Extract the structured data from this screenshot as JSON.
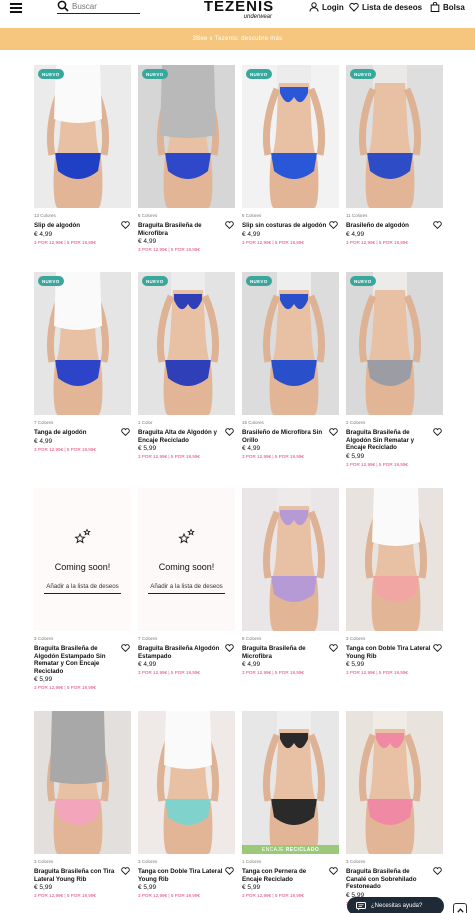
{
  "header": {
    "search_placeholder": "Buscar",
    "logo": "TEZENIS",
    "logo_sub": "underwear",
    "login": "Login",
    "wishlist": "Lista de deseos",
    "bag": "Bolsa"
  },
  "promo": "3Bee x Tezenis: descubre más",
  "colors": {
    "badge": "#3aa79c",
    "promo_bar": "#f6c67e",
    "promo_price": "#e0457b",
    "recycled": "#9ac97a"
  },
  "products": [
    {
      "badge": "NUEVO",
      "colors": "13 Colores",
      "title": "Slip de algodón",
      "price": "€ 4,99",
      "promo": "3 POR 12,99€ | 5 POR 19,99€"
    },
    {
      "badge": "NUEVO",
      "colors": "6 Colores",
      "title": "Braguita Brasileña de Microfibra",
      "price": "€ 4,99",
      "promo": "3 POR 12,99€ | 5 POR 19,99€"
    },
    {
      "badge": "NUEVO",
      "colors": "6 Colores",
      "title": "Slip sin costuras de algodón",
      "price": "€ 4,99",
      "promo": "3 POR 12,99€ | 5 POR 19,99€"
    },
    {
      "badge": "NUEVO",
      "colors": "11 Colores",
      "title": "Brasileño de algodón",
      "price": "€ 4,99",
      "promo": "3 POR 12,99€ | 5 POR 19,99€"
    },
    {
      "badge": "NUEVO",
      "colors": "7 Colores",
      "title": "Tanga de algodón",
      "price": "€ 4,99",
      "promo": "3 POR 12,99€ | 5 POR 19,99€"
    },
    {
      "badge": "NUEVO",
      "colors": "1 Color",
      "title": "Braguita Alta de Algodón y Encaje Reciclado",
      "price": "€ 5,99",
      "promo": "3 POR 12,99€ | 5 POR 19,99€"
    },
    {
      "badge": "NUEVO",
      "colors": "15 Colores",
      "title": "Brasileño de Microfibra Sin Orillo",
      "price": "€ 4,99",
      "promo": "3 POR 12,99€ | 5 POR 19,99€"
    },
    {
      "badge": "NUEVO",
      "colors": "2 Colores",
      "title": "Braguita Brasileña de Algodón Sin Rematar y Encaje Reciclado",
      "price": "€ 5,99",
      "promo": "3 POR 12,99€ | 5 POR 19,99€"
    },
    {
      "badge": "",
      "colors": "3 Colores",
      "title": "Braguita Brasileña de Algodón Estampado Sin Rematar y Con Encaje Reciclado",
      "price": "€ 5,99",
      "promo": "3 POR 12,99€ | 5 POR 19,99€"
    },
    {
      "badge": "",
      "colors": "7 Colores",
      "title": "Braguita Brasileña Algodón Estampado",
      "price": "€ 4,99",
      "promo": "3 POR 12,99€ | 5 POR 19,99€"
    },
    {
      "badge": "",
      "colors": "8 Colores",
      "title": "Braguita Brasileña de Microfibra",
      "price": "€ 4,99",
      "promo": "3 POR 12,99€ | 5 POR 19,99€"
    },
    {
      "badge": "",
      "colors": "3 Colores",
      "title": "Tanga con Doble Tira Lateral Young Rib",
      "price": "€ 5,99",
      "promo": "3 POR 12,99€ | 5 POR 19,99€"
    },
    {
      "badge": "",
      "colors": "3 Colores",
      "title": "Braguita Brasileña con Tira Lateral Young Rib",
      "price": "€ 5,99",
      "promo": "3 POR 12,99€ | 5 POR 19,99€"
    },
    {
      "badge": "",
      "colors": "3 Colores",
      "title": "Tanga con Doble Tira Lateral Young Rib",
      "price": "€ 5,99",
      "promo": "3 POR 12,99€ | 5 POR 19,99€"
    },
    {
      "badge": "",
      "colors": "1 Colores",
      "title": "Tanga con Pernera de Encaje Reciclado",
      "price": "€ 5,99",
      "promo": "3 POR 12,99€ | 5 POR 19,99€"
    },
    {
      "badge": "",
      "colors": "3 Colores",
      "title": "Braguita Brasileña de Canalé con Sobrehilado Festoneado",
      "price": "€ 5,99",
      "promo": "3 POR 12,99€ | 5 POR 19,99€"
    }
  ],
  "coming_soon": {
    "title": "Coming soon!",
    "link": "Añadir a la lista de deseos"
  },
  "recycled_label": {
    "prefix": "ENCAJE",
    "word": "RECICLADO"
  },
  "chat": "¿Necesitas ayuda?"
}
